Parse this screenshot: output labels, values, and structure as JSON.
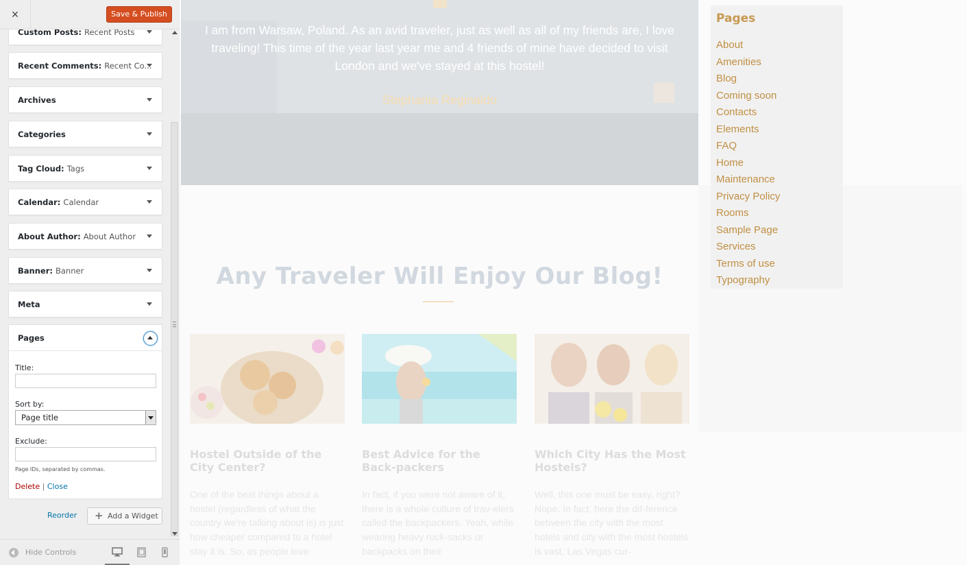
{
  "header": {
    "close_label": "×",
    "save_label": "Save & Publish"
  },
  "widgets": [
    {
      "title": "Custom Posts:",
      "subtitle": "Recent Posts"
    },
    {
      "title": "Recent Comments:",
      "subtitle": "Recent Co..."
    },
    {
      "title": "Archives",
      "subtitle": ""
    },
    {
      "title": "Categories",
      "subtitle": ""
    },
    {
      "title": "Tag Cloud:",
      "subtitle": "Tags"
    },
    {
      "title": "Calendar:",
      "subtitle": "Calendar"
    },
    {
      "title": "About Author:",
      "subtitle": "About Author"
    },
    {
      "title": "Banner:",
      "subtitle": "Banner"
    },
    {
      "title": "Meta",
      "subtitle": ""
    }
  ],
  "pages_widget": {
    "title": "Pages",
    "title_label": "Title:",
    "title_value": "",
    "sort_label": "Sort by:",
    "sort_value": "Page title",
    "exclude_label": "Exclude:",
    "exclude_value": "",
    "hint": "Page IDs, separated by commas.",
    "delete_label": "Delete",
    "separator": "|",
    "close_label": "Close"
  },
  "actions": {
    "reorder_label": "Reorder",
    "add_widget_label": "Add a Widget"
  },
  "footer": {
    "hide_controls_label": "Hide Controls",
    "devices": [
      "desktop-icon",
      "tablet-icon",
      "mobile-icon"
    ],
    "active_device": "desktop"
  },
  "preview": {
    "testimonial_text": "I am from Warsaw, Poland. As an avid traveler, just as well as all of my friends are, I love traveling! This time of the year last year me and 4 friends of mine have decided to visit London and we've stayed at this hostel!",
    "testimonial_author": "Stephania Reginaldo",
    "blog_heading": "Any Traveler Will Enjoy Our Blog!",
    "posts": [
      {
        "title": "Hostel Outside of the City Center?",
        "excerpt": "One of the best things about a hostel (regardless of what the country we're talking about is) is just how cheaper compared to a hotel stay it is. So, as people love"
      },
      {
        "title": "Best Advice for the Back-packers",
        "excerpt": "In fact, if you were not aware of it, there is a whole culture of trav-elers called the backpackers. Yeah, while wearing heavy ruck-sacks or backpacks on their"
      },
      {
        "title": "Which City Has the Most Hostels?",
        "excerpt": "Well, this one must be easy, right? Nope. In fact, here the dif-ference between the city with the most hotels and city with the most hostels is vast. Las Vegas cur-"
      }
    ],
    "pages_box": {
      "title": "Pages",
      "items": [
        "About",
        "Amenities",
        "Blog",
        "Coming soon",
        "Contacts",
        "Elements",
        "FAQ",
        "Home",
        "Maintenance",
        "Privacy Policy",
        "Rooms",
        "Sample Page",
        "Services",
        "Terms of use",
        "Typography"
      ]
    }
  },
  "colors": {
    "save_button": "#d54e21",
    "link_blue": "#0073aa",
    "delete_red": "#a00000",
    "page_link_gold": "#c08f43",
    "heading_faded": "#d1d8df"
  }
}
